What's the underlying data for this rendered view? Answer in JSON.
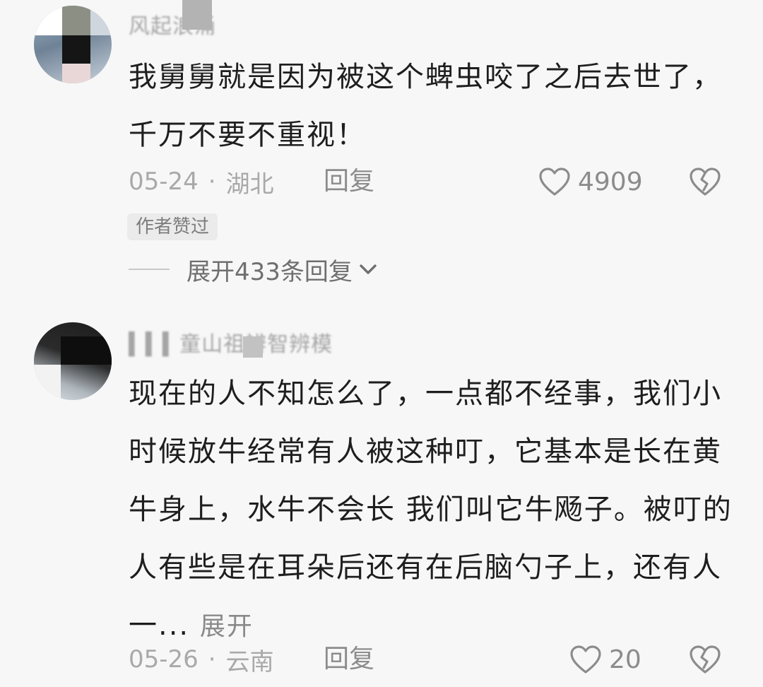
{
  "comments": [
    {
      "username": "风起浪涌",
      "text": "我舅舅就是因为被这个蜱虫咬了之后去世了，千万不要不重视！",
      "date": "05-24",
      "separator": "·",
      "location": "湖北",
      "reply_label": "回复",
      "like_count": "4909",
      "badge": "作者赞过",
      "expand_replies": "展开433条回复",
      "icons": {
        "like": "heart-outline-icon",
        "dislike": "broken-heart-icon",
        "expand": "chevron-down-icon"
      }
    },
    {
      "username": "▍▍▍童山祖辨智辨模",
      "text": "现在的人不知怎么了，一点都不经事，我们小时候放牛经常有人被这种叮，它基本是长在黄牛身上，水牛不会长 我们叫它牛飏子。被叮的人有些是在耳朵后还有在后脑勺子上，还有人一...",
      "expand_label": "展开",
      "date": "05-26",
      "separator": "·",
      "location": "云南",
      "reply_label": "回复",
      "like_count": "20",
      "icons": {
        "like": "heart-outline-icon",
        "dislike": "broken-heart-icon"
      }
    }
  ],
  "colors": {
    "background": "#f7f7f7",
    "text_primary": "#1e1e1e",
    "text_secondary": "#a9a9a9",
    "badge_bg": "#ebebeb"
  }
}
